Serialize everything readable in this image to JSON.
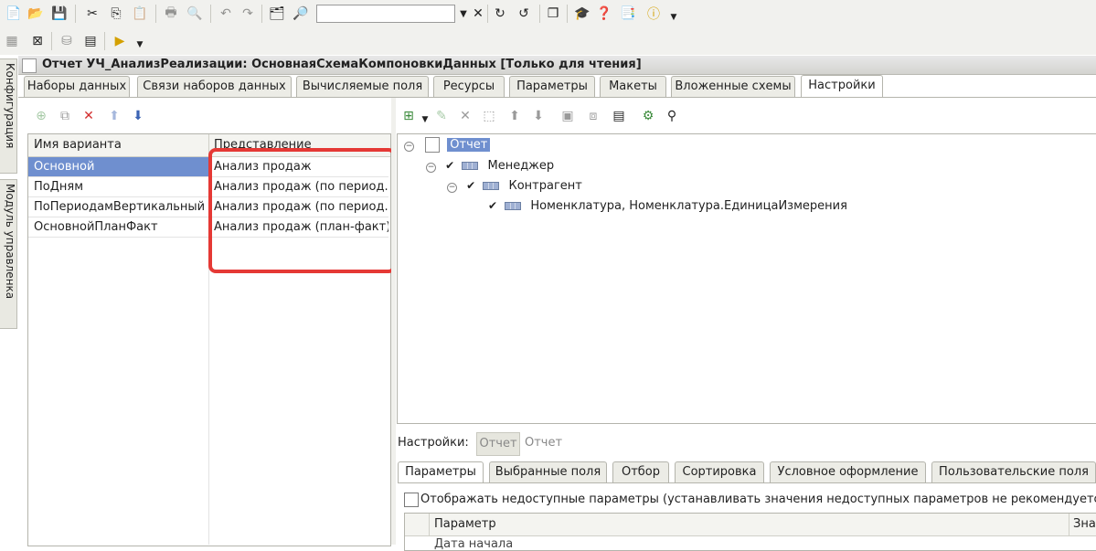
{
  "toolbar1": {
    "search": {
      "value": "",
      "placeholder": ""
    }
  },
  "side_tabs": [
    "Конфигурация",
    "Модуль управленка"
  ],
  "window": {
    "title": "Отчет УЧ_АнализРеализации: ОсновнаяСхемаКомпоновкиДанных [Только для чтения]"
  },
  "tabs": [
    "Наборы данных",
    "Связи наборов данных",
    "Вычисляемые поля",
    "Ресурсы",
    "Параметры",
    "Макеты",
    "Вложенные схемы",
    "Настройки"
  ],
  "active_tab": "Настройки",
  "variants": {
    "columns": [
      "Имя варианта",
      "Представление"
    ],
    "rows": [
      {
        "name": "Основной",
        "view": "Анализ продаж"
      },
      {
        "name": "ПоДням",
        "view": "Анализ продаж (по период..."
      },
      {
        "name": "ПоПериодамВертикальный",
        "view": "Анализ продаж (по период..."
      },
      {
        "name": "ОсновнойПланФакт",
        "view": "Анализ продаж (план-факт)"
      }
    ],
    "selected_row": 0,
    "highlight_color": "#e53935"
  },
  "structure": {
    "root": "Отчет",
    "level1": "Менеджер",
    "level2": "Контрагент",
    "level3": "Номенклатура, Номенклатура.ЕдиницаИзмерения"
  },
  "settings_bar": {
    "label": "Настройки:",
    "button": "Отчет",
    "value": "Отчет"
  },
  "bottom_tabs": [
    "Параметры",
    "Выбранные поля",
    "Отбор",
    "Сортировка",
    "Условное оформление",
    "Пользовательские поля"
  ],
  "show_unavailable": "Отображать недоступные параметры (устанавливать значения недоступных параметров не рекомендуется)",
  "params_table": {
    "columns": [
      "Параметр",
      "Зна"
    ],
    "first_row": "Дата начала"
  },
  "colors": {
    "selection": "#6f8fcf",
    "accent": "#3c64b4"
  }
}
